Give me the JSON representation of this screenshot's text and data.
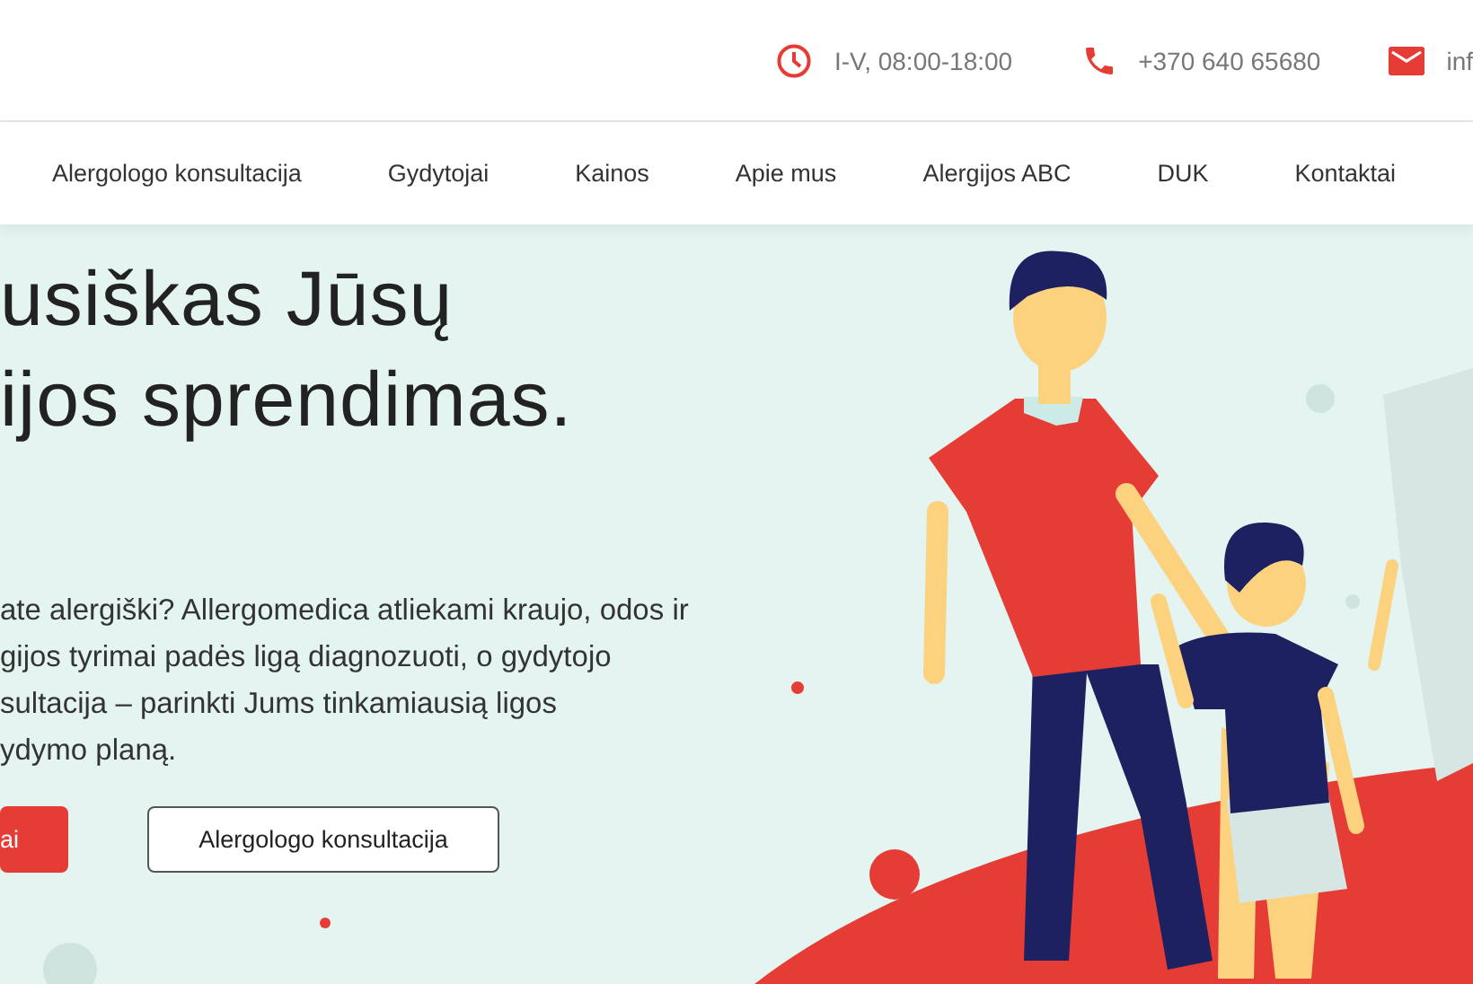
{
  "contacts": [
    {
      "kind": "clock",
      "text": "I-V, 08:00-18:00"
    },
    {
      "kind": "phone",
      "text": "+370 640 65680"
    },
    {
      "kind": "mail",
      "text": "inf"
    }
  ],
  "nav": [
    {
      "label": "Alergologo konsultacija"
    },
    {
      "label": "Gydytojai"
    },
    {
      "label": "Kainos"
    },
    {
      "label": "Apie mus"
    },
    {
      "label": "Alergijos ABC"
    },
    {
      "label": "DUK"
    },
    {
      "label": "Kontaktai"
    }
  ],
  "hero": {
    "headline": [
      "usiškas Jūsų",
      "ijos sprendimas."
    ],
    "paragraph": [
      "ate alergiški? Allergomedica atliekami kraujo, odos ir",
      "gijos tyrimai padės ligą diagnozuoti, o gydytojo",
      "sultacija – parinkti Jums tinkamiausią ligos",
      "ydymo planą."
    ],
    "buttons": [
      {
        "kind": "primary",
        "label": "ai"
      },
      {
        "kind": "outline",
        "label": "Alergologo konsultacija"
      }
    ]
  }
}
